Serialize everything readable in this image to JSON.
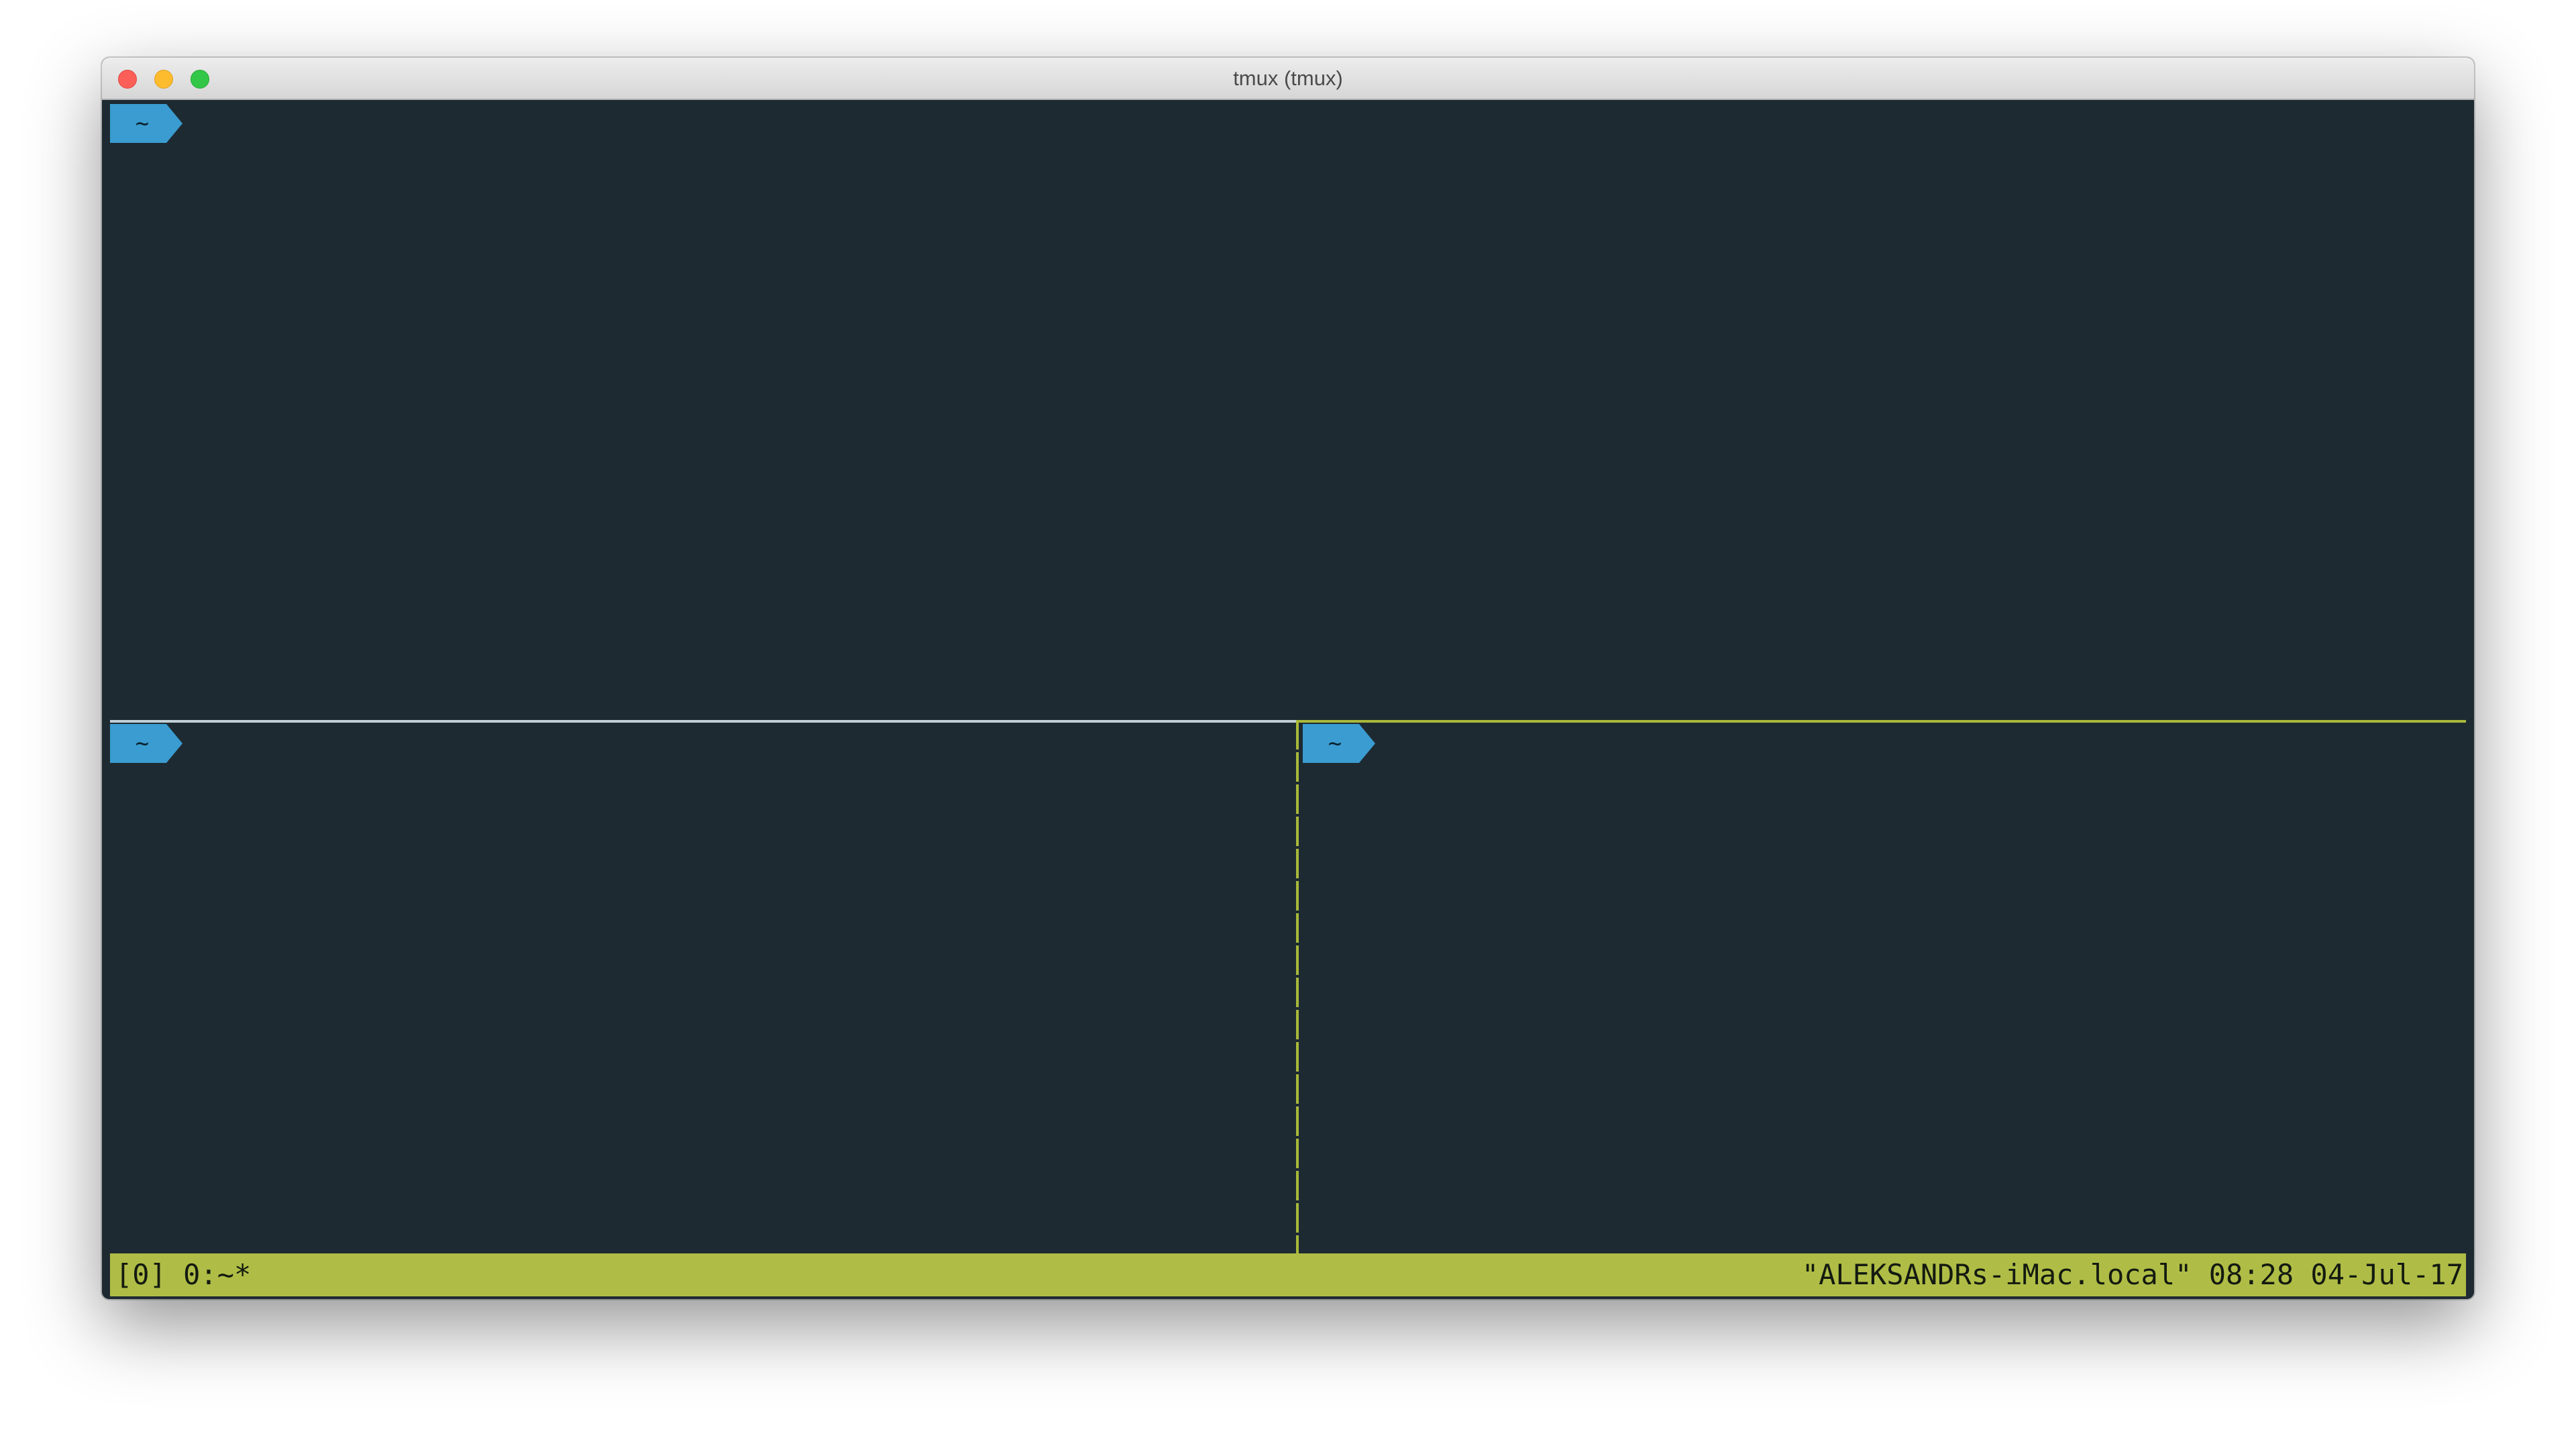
{
  "window": {
    "title": "tmux (tmux)"
  },
  "panes": [
    {
      "prompt": "~"
    },
    {
      "prompt": "~"
    },
    {
      "prompt": "~"
    }
  ],
  "statusbar": {
    "left": "[0] 0:~*",
    "right": "\"ALEKSANDRs-iMac.local\" 08:28 04-Jul-17"
  },
  "colors": {
    "terminal_bg": "#1e2a32",
    "prompt_bg": "#3a9cd0",
    "active_border": "#a8b83a",
    "inactive_border": "#c0ced6",
    "statusbar_bg": "#afbd46"
  }
}
